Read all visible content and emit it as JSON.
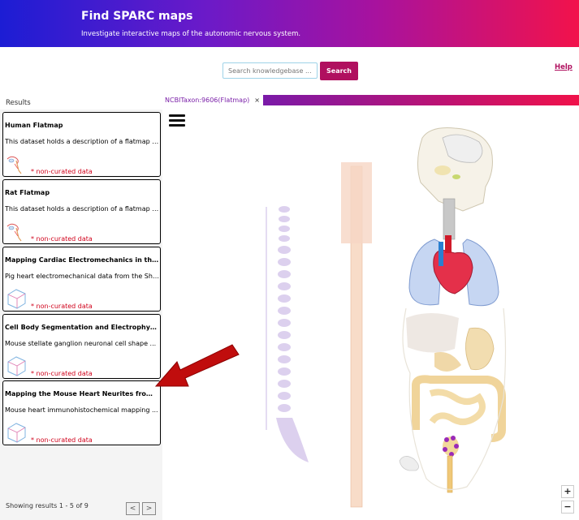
{
  "header": {
    "title": "Find SPARC maps",
    "subtitle": "Investigate interactive maps of the autonomic nervous system."
  },
  "search": {
    "placeholder": "Search knowledgebase ...",
    "button_label": "Search"
  },
  "help_label": "Help",
  "results": {
    "title": "Results",
    "cards": [
      {
        "title": "Human Flatmap",
        "description": "This dataset holds a description of a flatmap r...",
        "flag": "* non-curated data",
        "thumb": "flatmap-icon"
      },
      {
        "title": "Rat Flatmap",
        "description": "This dataset holds a description of a flatmap r...",
        "flag": "* non-curated data",
        "thumb": "flatmap-icon"
      },
      {
        "title": "Mapping Cardiac Electromechanics in the Pig",
        "description": "Pig heart electromechanical data from the Shi...",
        "flag": "* non-curated data",
        "thumb": "scaffold-cube-icon"
      },
      {
        "title": "Cell Body Segmentation and Electrophysiolog...",
        "description": "Mouse stellate ganglion neuronal cell shape ...",
        "flag": "* non-curated data",
        "thumb": "scaffold-cube-icon"
      },
      {
        "title": "Mapping the Mouse Heart Neurites from Imag...",
        "description": "Mouse heart immunohistochemical mapping ...",
        "flag": "* non-curated data",
        "thumb": "scaffold-cube-icon"
      }
    ],
    "showing": "Showing results 1 - 5 of 9",
    "prev_label": "<",
    "next_label": ">"
  },
  "map": {
    "tab_label": "NCBITaxon:9606(Flatmap)",
    "tab_close": "×",
    "zoom_in": "+",
    "zoom_out": "−"
  },
  "colors": {
    "accent": "#b0105f",
    "flag": "#d0021b",
    "tab_text": "#7a1fa8"
  }
}
